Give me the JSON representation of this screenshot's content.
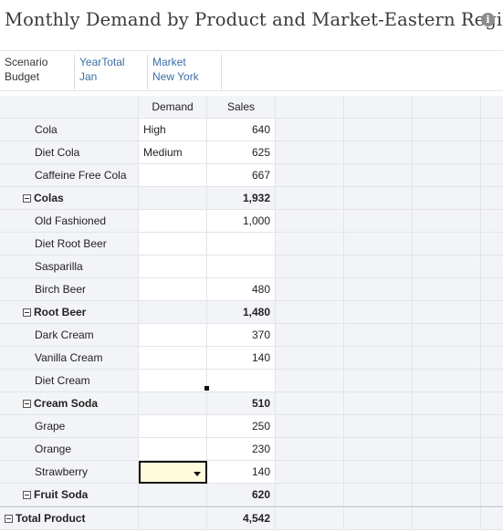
{
  "header": {
    "title": "Monthly Demand by Product and Market-Eastern Region",
    "info_icon": "info-icon"
  },
  "pov": [
    {
      "dimension": "Scenario",
      "member": "Budget",
      "style": "plain"
    },
    {
      "dimension": "YearTotal",
      "member": "Jan",
      "style": "link"
    },
    {
      "dimension": "Market",
      "member": "New York",
      "style": "link"
    }
  ],
  "grid": {
    "columns": [
      "Demand",
      "Sales"
    ],
    "rows": [
      {
        "label": "Cola",
        "level": "child",
        "demand": "High",
        "sales": "640"
      },
      {
        "label": "Diet Cola",
        "level": "child",
        "demand": "Medium",
        "sales": "625"
      },
      {
        "label": "Caffeine Free Cola",
        "level": "child",
        "demand": "",
        "sales": "667"
      },
      {
        "label": "Colas",
        "level": "parent",
        "demand": "",
        "sales": "1,932"
      },
      {
        "label": "Old Fashioned",
        "level": "child",
        "demand": "",
        "sales": "1,000"
      },
      {
        "label": "Diet Root Beer",
        "level": "child",
        "demand": "",
        "sales": ""
      },
      {
        "label": "Sasparilla",
        "level": "child",
        "demand": "",
        "sales": ""
      },
      {
        "label": "Birch Beer",
        "level": "child",
        "demand": "",
        "sales": "480"
      },
      {
        "label": "Root Beer",
        "level": "parent",
        "demand": "",
        "sales": "1,480"
      },
      {
        "label": "Dark Cream",
        "level": "child",
        "demand": "",
        "sales": "370"
      },
      {
        "label": "Vanilla Cream",
        "level": "child",
        "demand": "",
        "sales": "140"
      },
      {
        "label": "Diet Cream",
        "level": "child",
        "demand": "",
        "sales": ""
      },
      {
        "label": "Cream Soda",
        "level": "parent",
        "demand": "",
        "sales": "510"
      },
      {
        "label": "Grape",
        "level": "child",
        "demand": "",
        "sales": "250"
      },
      {
        "label": "Orange",
        "level": "child",
        "demand": "",
        "sales": "230"
      },
      {
        "label": "Strawberry",
        "level": "child",
        "demand": "",
        "sales": "140",
        "selected": true
      },
      {
        "label": "Fruit Soda",
        "level": "parent",
        "demand": "",
        "sales": "620"
      },
      {
        "label": "Total Product",
        "level": "grand",
        "demand": "",
        "sales": "4,542"
      }
    ]
  },
  "colors": {
    "title": "#3a3a3a",
    "link": "#3b6fa6",
    "row_header_bg": "#f3f4f7",
    "selected_bg": "#fffbdc"
  }
}
